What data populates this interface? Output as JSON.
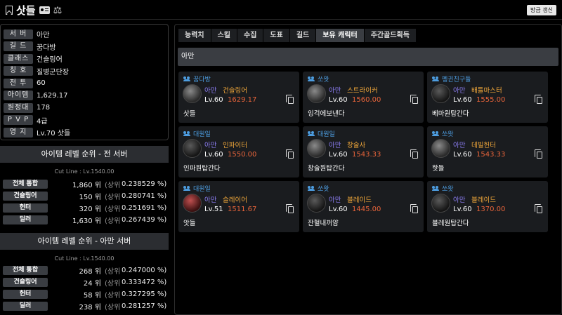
{
  "header": {
    "title": "삿들",
    "refresh_label": "방금 갱신"
  },
  "profile": [
    {
      "label": "서 버",
      "value": "아만"
    },
    {
      "label": "길 드",
      "value": "꿈다방"
    },
    {
      "label": "클래스",
      "value": "건슬링어"
    },
    {
      "label": "칭 호",
      "value": "질병군단장"
    },
    {
      "label": "전 투",
      "value": "60"
    },
    {
      "label": "아이템",
      "value": "1,629.17"
    },
    {
      "label": "원정대",
      "value": "178"
    },
    {
      "label": "P V P",
      "value": "4급"
    },
    {
      "label": "영 지",
      "value": "Lv.70 삿들"
    }
  ],
  "ranking_all": {
    "title": "아이템 레벨 순위 - 전 서버",
    "cutline": "Cut Line : Lv.1540.00",
    "rows": [
      {
        "label": "전체 통합",
        "value": "1,860 위",
        "paren": "(상위",
        "pct": "0.238529 %)"
      },
      {
        "label": "건슬링어",
        "value": "150 위",
        "paren": "(상위",
        "pct": "0.280741 %)"
      },
      {
        "label": "헌터",
        "value": "320 위",
        "paren": "(상위",
        "pct": "0.251691 %)"
      },
      {
        "label": "딜러",
        "value": "1,630 위",
        "paren": "(상위",
        "pct": "0.267439 %)"
      }
    ]
  },
  "ranking_server": {
    "title": "아이템 레벨 순위 - 아만 서버",
    "cutline": "Cut Line : Lv.1540.00",
    "rows": [
      {
        "label": "전체 통합",
        "value": "268 위",
        "paren": "(상위",
        "pct": "0.247000 %)"
      },
      {
        "label": "건슬링어",
        "value": "24 위",
        "paren": "(상위",
        "pct": "0.333472 %)"
      },
      {
        "label": "헌터",
        "value": "58 위",
        "paren": "(상위",
        "pct": "0.327295 %)"
      },
      {
        "label": "딜러",
        "value": "238 위",
        "paren": "(상위",
        "pct": "0.281257 %)"
      }
    ]
  },
  "tabs": [
    "능력치",
    "스킬",
    "수집",
    "도표",
    "길드",
    "보유 캐릭터",
    "주간골드획득"
  ],
  "active_tab_index": 5,
  "server_bar": "아만",
  "characters": [
    {
      "guild": "꿈다방",
      "server": "아만",
      "class": "건슬링어",
      "level": "Lv.60",
      "ilvl": "1629.17",
      "name": "삿들",
      "avatar": "grey"
    },
    {
      "guild": "쏘왓",
      "server": "아만",
      "class": "스트라이커",
      "level": "Lv.60",
      "ilvl": "1560.00",
      "name": "잉걱에보낸다",
      "avatar": "grey"
    },
    {
      "guild": "펭귄친구들",
      "server": "아만",
      "class": "배틀마스터",
      "level": "Lv.60",
      "ilvl": "1555.00",
      "name": "베마원탑간다",
      "avatar": "dark"
    },
    {
      "guild": "대원일",
      "server": "아만",
      "class": "인파이터",
      "level": "Lv.60",
      "ilvl": "1550.00",
      "name": "인파원탑간다",
      "avatar": "dark"
    },
    {
      "guild": "대원일",
      "server": "아만",
      "class": "창술사",
      "level": "Lv.60",
      "ilvl": "1543.33",
      "name": "창술원탑간다",
      "avatar": "grey"
    },
    {
      "guild": "쏘왓",
      "server": "아만",
      "class": "데빌헌터",
      "level": "Lv.60",
      "ilvl": "1543.33",
      "name": "핫들",
      "avatar": "grey"
    },
    {
      "guild": "대원일",
      "server": "아만",
      "class": "슬레이어",
      "level": "Lv.51",
      "ilvl": "1511.67",
      "name": "앗들",
      "avatar": "red"
    },
    {
      "guild": "쏘왓",
      "server": "아만",
      "class": "블레이드",
      "level": "Lv.60",
      "ilvl": "1445.00",
      "name": "잔혈내꺼얌",
      "avatar": "dark"
    },
    {
      "guild": "쏘왓",
      "server": "아만",
      "class": "블레이드",
      "level": "Lv.60",
      "ilvl": "1370.00",
      "name": "블레원탑간다",
      "avatar": "dark"
    }
  ]
}
